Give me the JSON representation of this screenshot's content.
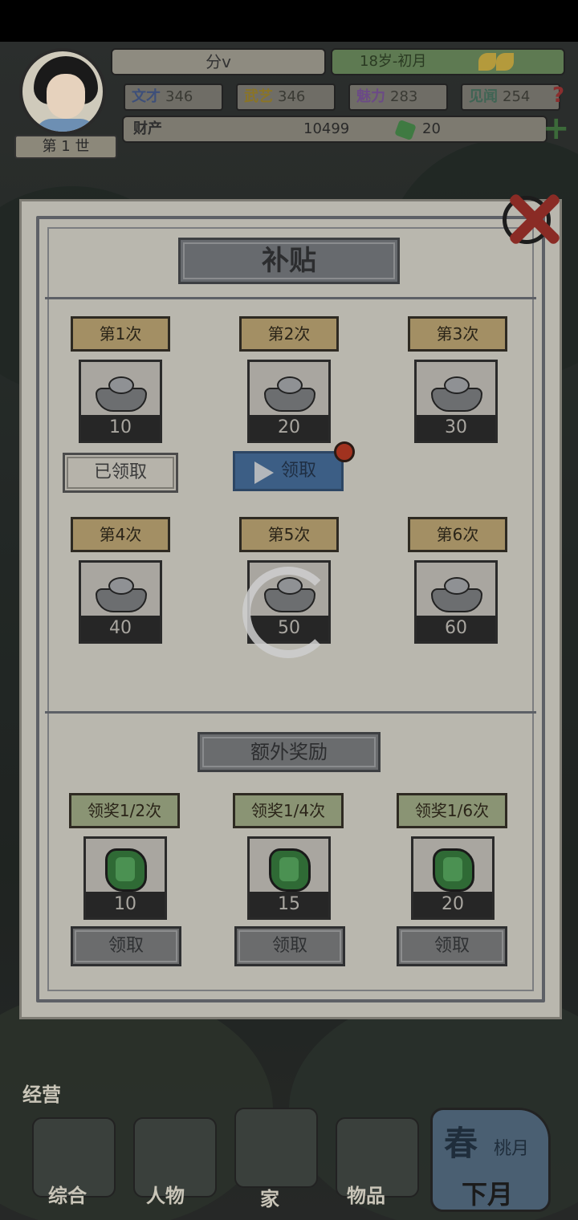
{
  "hud": {
    "name": "分v",
    "age": "18岁-初月",
    "generation": "第 1 世",
    "stats": [
      {
        "label": "文才",
        "value": "346",
        "color": "#3d4f7a"
      },
      {
        "label": "武艺",
        "value": "346",
        "color": "#8a7426"
      },
      {
        "label": "魅力",
        "value": "283",
        "color": "#6b4a86"
      },
      {
        "label": "见闻",
        "value": "254",
        "color": "#3f6454"
      }
    ],
    "wealth_label": "财产",
    "silver": "10499",
    "jade": "20"
  },
  "panel": {
    "title": "补贴",
    "slots": [
      {
        "label": "第1次",
        "amount": "10"
      },
      {
        "label": "第2次",
        "amount": "20"
      },
      {
        "label": "第3次",
        "amount": "30"
      },
      {
        "label": "第4次",
        "amount": "40"
      },
      {
        "label": "第5次",
        "amount": "50"
      },
      {
        "label": "第6次",
        "amount": "60"
      }
    ],
    "claimed_label": "已领取",
    "claim_label": "领取",
    "extra_title": "额外奖励",
    "extra": [
      {
        "label": "领奖1/2次",
        "amount": "10",
        "button": "领取"
      },
      {
        "label": "领奖1/4次",
        "amount": "15",
        "button": "领取"
      },
      {
        "label": "领奖1/6次",
        "amount": "20",
        "button": "领取"
      }
    ]
  },
  "bottom": {
    "section_label": "经营",
    "nav": [
      "综合",
      "人物",
      "家",
      "物品"
    ],
    "season": "春",
    "month": "桃月",
    "next_month": "下月"
  }
}
